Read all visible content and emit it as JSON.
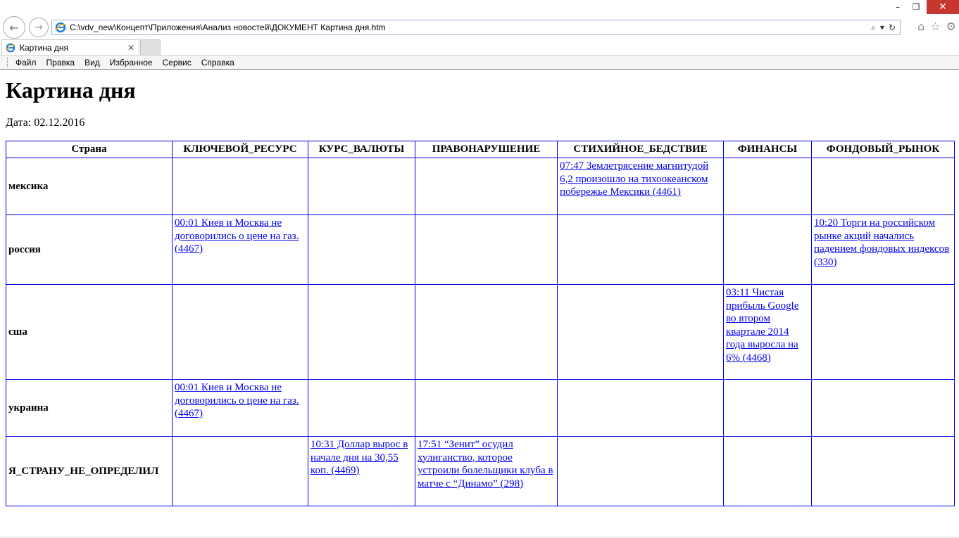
{
  "window": {
    "minimize": "–",
    "restore": "❐",
    "close": "✕"
  },
  "nav": {
    "back_icon": "←",
    "forward_icon": "→",
    "address": "C:\\vdv_new\\Концепт\\Приложения\\Анализ новостей\\ДОКУМЕНТ Картина дня.htm",
    "search_icon": "⌕",
    "dropdown_icon": "▾",
    "refresh_icon": "↻",
    "home_icon": "⌂",
    "favorites_icon": "☆",
    "settings_icon": "⚙"
  },
  "tabs": [
    {
      "title": "Картина дня",
      "close": "✕"
    }
  ],
  "menu": [
    "Файл",
    "Правка",
    "Вид",
    "Избранное",
    "Сервис",
    "Справка"
  ],
  "page": {
    "title": "Картина дня",
    "date_label": "Дата: 02.12.2016"
  },
  "table": {
    "headers": [
      "Страна",
      "КЛЮЧЕВОЙ_РЕСУРС",
      "КУРС_ВАЛЮТЫ",
      "ПРАВОНАРУШЕНИЕ",
      "СТИХИЙНОЕ_БЕДСТВИЕ",
      "ФИНАНСЫ",
      "ФОНДОВЫЙ_РЫНОК"
    ],
    "rows": [
      {
        "country": "мексика",
        "cells": [
          "",
          "",
          "",
          "07:47 Землетрясение магнитудой 6,2 произошло на тихоокеанском побережье Мексики (4461)",
          "",
          ""
        ]
      },
      {
        "country": "россия",
        "cells": [
          "00:01 Киев и Москва не договорились о цене на газ. (4467)",
          "",
          "",
          "",
          "",
          "10:20 Торги на российском рынке акций начались падением фондовых индексов (330)"
        ]
      },
      {
        "country": "сша",
        "cells": [
          "",
          "",
          "",
          "",
          "03:11 Чистая прибыль Google во втором квартале 2014 года выросла на 6% (4468)",
          ""
        ]
      },
      {
        "country": "украина",
        "cells": [
          "00:01 Киев и Москва не договорились о цене на газ. (4467)",
          "",
          "",
          "",
          "",
          ""
        ]
      },
      {
        "country": "Я_СТРАНУ_НЕ_ОПРЕДЕЛИЛ",
        "cells": [
          "",
          "10:31 Доллар вырос в начале дня на 30,55 коп. (4469)",
          "17:51 “Зенит” осудил хулиганство, которое устроили болельщики клуба в матче с “Динамо” (298)",
          "",
          "",
          ""
        ]
      }
    ]
  },
  "colors": {
    "link": "#0000ee",
    "table_border": "#0000ee",
    "close_button": "#c7372f"
  }
}
